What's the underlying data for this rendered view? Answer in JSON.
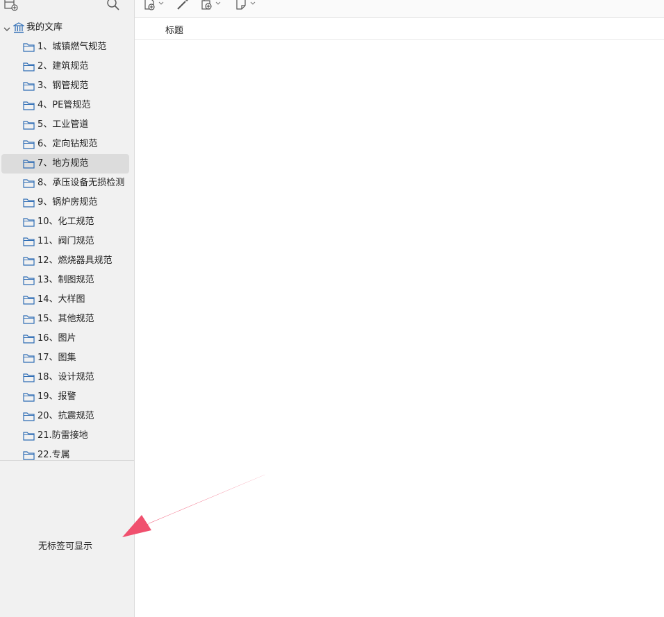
{
  "sidebar": {
    "library_name": "我的文库",
    "folders": [
      {
        "label": "1、城镇燃气规范"
      },
      {
        "label": "2、建筑规范"
      },
      {
        "label": "3、钢管规范"
      },
      {
        "label": "4、PE管规范"
      },
      {
        "label": "5、工业管道"
      },
      {
        "label": "6、定向钻规范"
      },
      {
        "label": "7、地方规范",
        "selected": true
      },
      {
        "label": "8、承压设备无损检测"
      },
      {
        "label": "9、锅炉房规范"
      },
      {
        "label": "10、化工规范"
      },
      {
        "label": "11、阀门规范"
      },
      {
        "label": "12、燃烧器具规范"
      },
      {
        "label": "13、制图规范"
      },
      {
        "label": "14、大样图"
      },
      {
        "label": "15、其他规范"
      },
      {
        "label": "16、图片"
      },
      {
        "label": "17、图集"
      },
      {
        "label": "18、设计规范"
      },
      {
        "label": "19、报警"
      },
      {
        "label": "20、抗震规范"
      },
      {
        "label": "21.防雷接地"
      },
      {
        "label": "22.专属"
      }
    ],
    "tags_empty_text": "无标签可显示"
  },
  "main": {
    "column_title": "标题"
  },
  "icons": {
    "add_library": "new-library-icon",
    "search": "search-icon",
    "new_item": "new-item-icon",
    "wand": "magic-wand-icon",
    "add_attachment": "add-attachment-icon",
    "new_note": "new-note-icon",
    "folder": "folder-icon",
    "library": "library-icon"
  },
  "colors": {
    "folder_stroke": "#2f6db5",
    "selected_row": "#dcdcdc",
    "annotation_arrow": "#f0506e"
  }
}
